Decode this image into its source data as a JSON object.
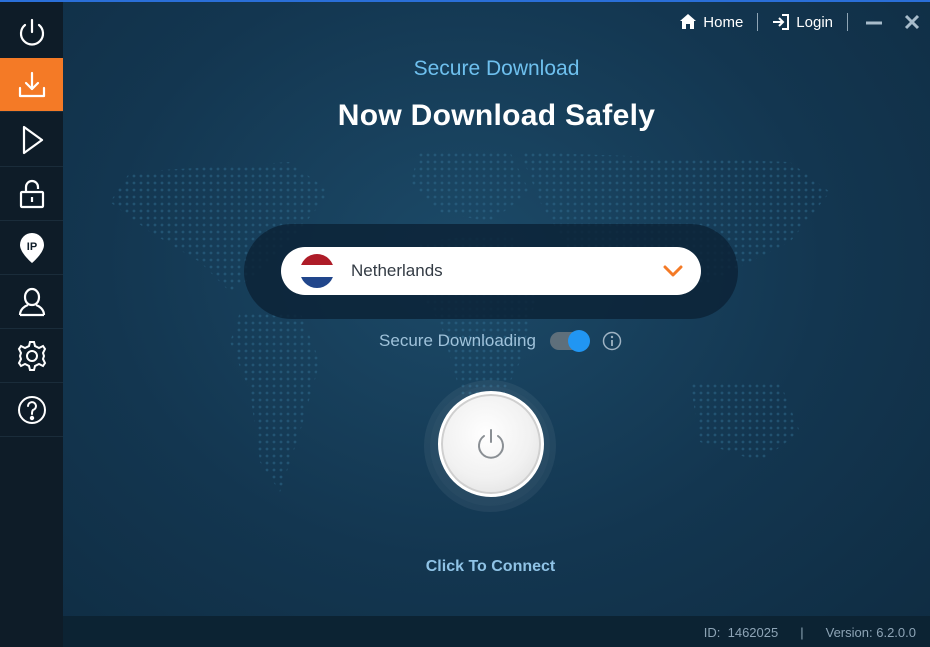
{
  "header": {
    "home_label": "Home",
    "login_label": "Login"
  },
  "sidebar": {
    "items": [
      {
        "icon": "power-icon"
      },
      {
        "icon": "download-icon",
        "active": true
      },
      {
        "icon": "play-icon"
      },
      {
        "icon": "lock-icon"
      },
      {
        "icon": "ip-location-icon"
      },
      {
        "icon": "user-icon"
      },
      {
        "icon": "gear-icon"
      },
      {
        "icon": "help-icon"
      }
    ]
  },
  "main": {
    "subtitle": "Secure Download",
    "title": "Now Download Safely",
    "country": {
      "selected": "Netherlands",
      "flag_colors": [
        "#ae1c28",
        "#ffffff",
        "#21468b"
      ]
    },
    "secure_toggle": {
      "label": "Secure Downloading",
      "on": true
    },
    "connect_label": "Click To Connect"
  },
  "footer": {
    "id_label": "ID:",
    "id_value": "1462025",
    "separator": "|",
    "version_label": "Version:",
    "version_value": "6.2.0.0"
  },
  "colors": {
    "accent": "#f47a26",
    "toggle_on": "#2196f3",
    "subtitle": "#6ec0ee"
  }
}
